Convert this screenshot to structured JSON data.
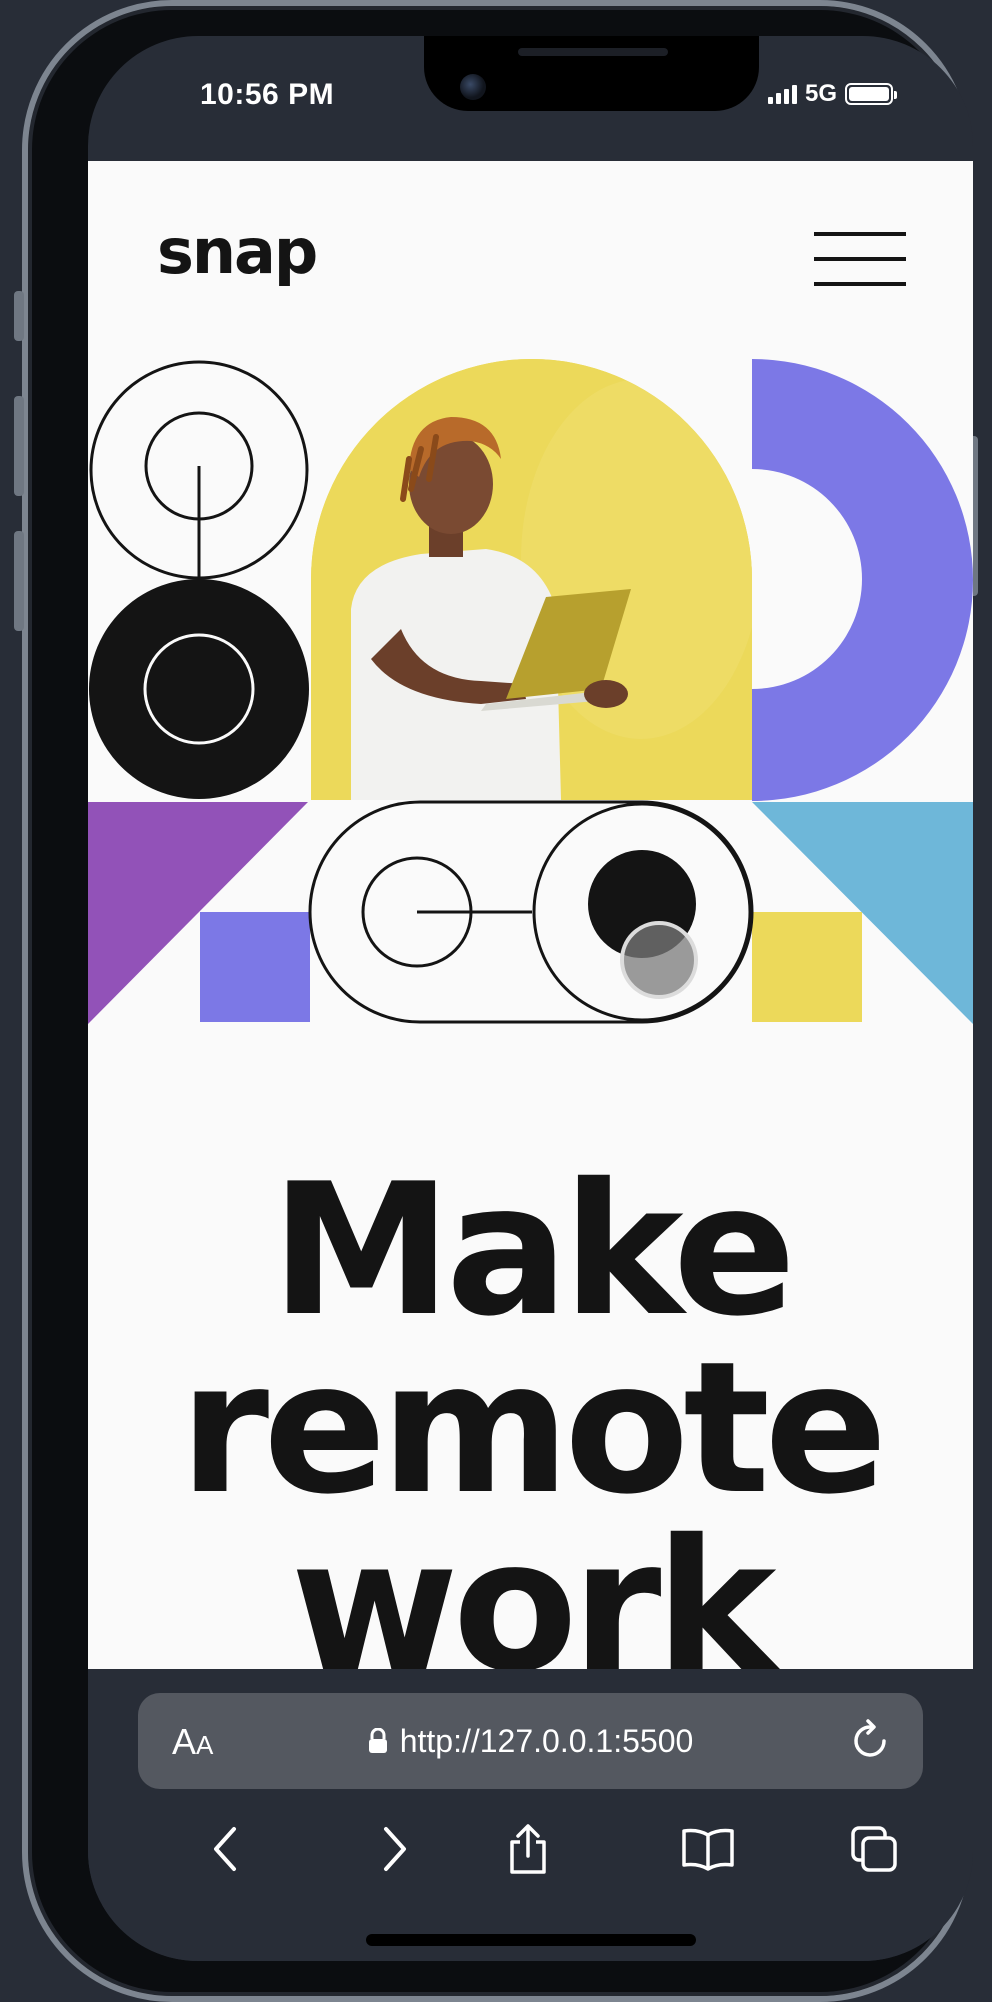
{
  "status_bar": {
    "time": "10:56 PM",
    "network": "5G"
  },
  "site": {
    "logo": "snap",
    "headline_lines": [
      "Make",
      "remote",
      "work"
    ]
  },
  "browser": {
    "text_size_label": "AA",
    "url": "http://127.0.0.1:5500"
  },
  "colors": {
    "page_bg": "#fafafa",
    "ink": "#141414",
    "yellow": "#ecd95a",
    "periwinkle": "#7c78e6",
    "violet": "#9252b8",
    "sky": "#6eb7d9",
    "browser_chrome": "#282d37"
  },
  "icons": {
    "menu": "hamburger-icon",
    "lock": "lock-icon",
    "reload": "reload-icon",
    "back": "chevron-left-icon",
    "forward": "chevron-right-icon",
    "share": "share-icon",
    "bookmarks": "book-icon",
    "tabs": "tabs-icon"
  }
}
